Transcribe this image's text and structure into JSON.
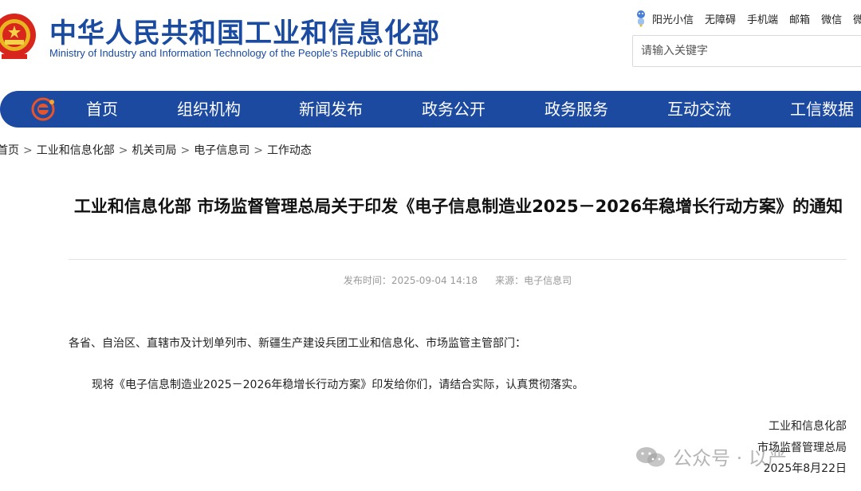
{
  "header": {
    "title_cn": "中华人民共和国工业和信息化部",
    "title_en": "Ministry of Industry and Information Technology of the People’s Republic of China",
    "emblem_icon": "national-emblem-icon",
    "top_links": [
      "阳光小信",
      "无障碍",
      "手机端",
      "邮箱",
      "微信",
      "微博"
    ],
    "search": {
      "placeholder": "请输入关键字",
      "value": ""
    }
  },
  "nav": {
    "logo_icon": "ministry-logo-icon",
    "items": [
      "首页",
      "组织机构",
      "新闻发布",
      "政务公开",
      "政务服务",
      "互动交流",
      "工信数据"
    ],
    "background_color": "#1c4aa0"
  },
  "breadcrumb": [
    "首页",
    "工业和信息化部",
    "机关司局",
    "电子信息司",
    "工作动态"
  ],
  "article": {
    "title": "工业和信息化部 市场监督管理总局关于印发《电子信息制造业2025－2026年稳增长行动方案》的通知",
    "publish_label": "发布时间：",
    "publish_time": "2025-09-04 14:18",
    "source_label": "来源：",
    "source": "电子信息司",
    "recipients": "各省、自治区、直辖市及计划单列市、新疆生产建设兵团工业和信息化、市场监管主管部门：",
    "body": "现将《电子信息制造业2025－2026年稳增长行动方案》印发给你们，请结合实际，认真贯彻落实。",
    "signatures": [
      "工业和信息化部",
      "市场监督管理总局"
    ],
    "date": "2025年8月22日"
  },
  "watermark": {
    "icon": "wechat-icon",
    "text": "公众号 · 以严"
  }
}
